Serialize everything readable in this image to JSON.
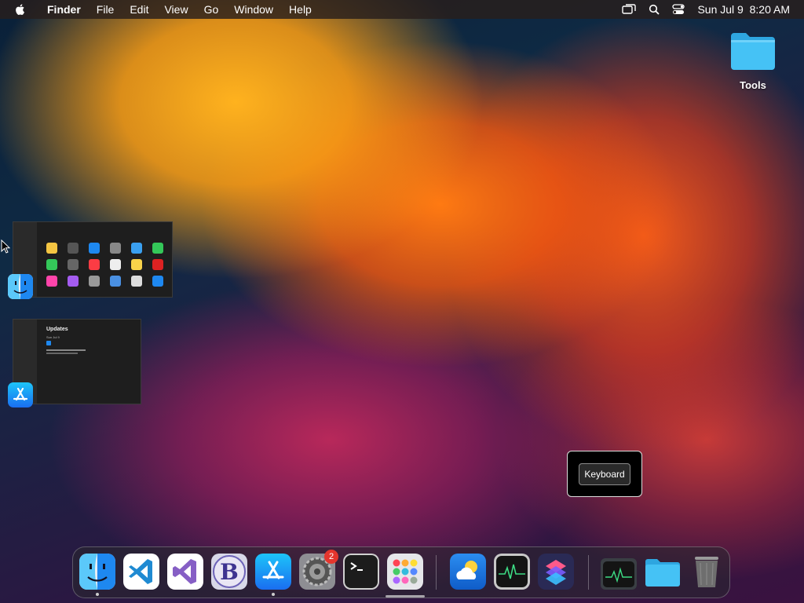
{
  "menubar": {
    "app_name": "Finder",
    "menus": [
      "File",
      "Edit",
      "View",
      "Go",
      "Window",
      "Help"
    ],
    "clock": "Sun Jul 9  8:20 AM",
    "icons": [
      "apple-icon",
      "screen-mirroring-icon",
      "spotlight-search-icon",
      "control-center-icon"
    ]
  },
  "desktop": {
    "folder_label": "Tools"
  },
  "app_switcher": {
    "finder_window": {
      "app": "Finder"
    },
    "appstore_window": {
      "app": "App Store",
      "title": "Updates",
      "subtitle": "Sun Jul 9"
    }
  },
  "popup": {
    "button_label": "Keyboard"
  },
  "dock": {
    "items": [
      {
        "name": "Finder",
        "icon": "finder-icon",
        "running": true
      },
      {
        "name": "Visual Studio Code",
        "icon": "vscode-icon",
        "running": false
      },
      {
        "name": "Visual Studio",
        "icon": "visual-studio-icon",
        "running": false
      },
      {
        "name": "BBEdit",
        "icon": "bbedit-icon",
        "running": false
      },
      {
        "name": "App Store",
        "icon": "app-store-icon",
        "running": true
      },
      {
        "name": "System Settings",
        "icon": "system-settings-icon",
        "running": false,
        "badge": "2"
      },
      {
        "name": "Terminal",
        "icon": "terminal-icon",
        "running": false
      },
      {
        "name": "Launchpad",
        "icon": "launchpad-icon",
        "running": false
      },
      {
        "name": "Weather",
        "icon": "weather-icon",
        "running": false
      },
      {
        "name": "Activity Monitor",
        "icon": "activity-monitor-icon",
        "running": false
      },
      {
        "name": "Shortcuts",
        "icon": "shortcuts-icon",
        "running": false
      },
      {
        "name": "Activity Monitor",
        "icon": "activity-monitor-minimized-icon",
        "running": false
      },
      {
        "name": "Folder",
        "icon": "folder-icon",
        "running": false
      },
      {
        "name": "Trash",
        "icon": "trash-icon",
        "running": false
      }
    ]
  },
  "colors": {
    "accent_blue": "#1e88f0",
    "badge_red": "#e5352d",
    "menubar_bg": "#28201c"
  }
}
